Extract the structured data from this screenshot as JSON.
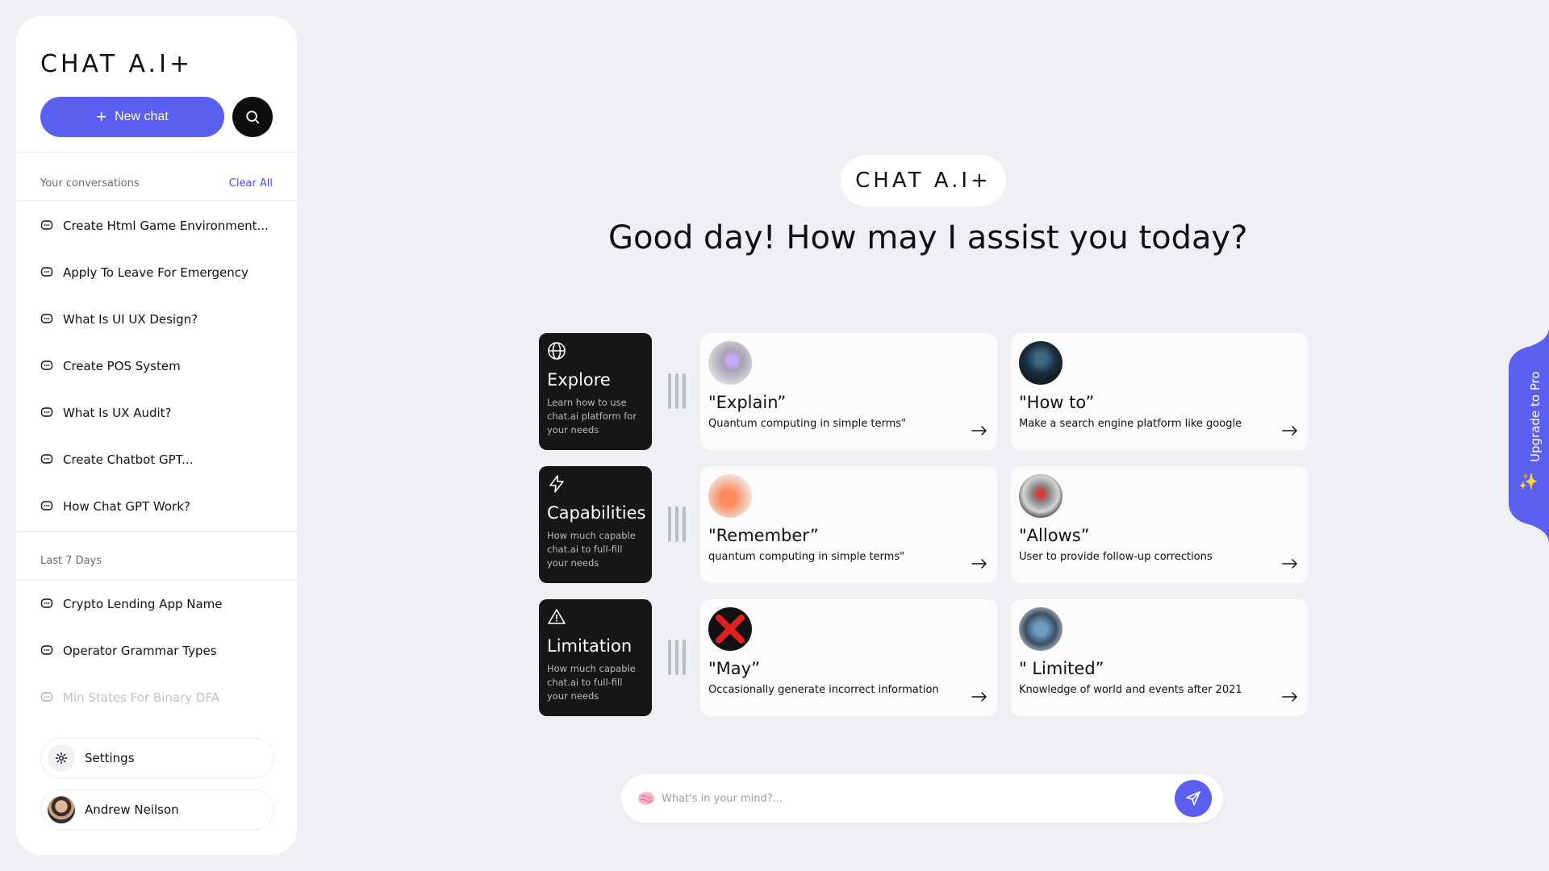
{
  "sidebar": {
    "logo": "CHAT A.I+",
    "new_chat_label": "New chat",
    "conversations_heading": "Your conversations",
    "clear_all_label": "Clear All",
    "conversations": [
      "Create Html Game Environment...",
      "Apply To Leave For Emergency",
      "What Is UI UX Design?",
      "Create POS System",
      "What Is UX Audit?",
      "Create Chatbot GPT...",
      "How Chat GPT Work?"
    ],
    "last7_heading": "Last 7 Days",
    "last7": [
      "Crypto Lending App Name",
      "Operator Grammar Types",
      "Min States For Binary DFA"
    ],
    "settings_label": "Settings",
    "user_name": "Andrew Neilson"
  },
  "main": {
    "brand": "CHAT A.I+",
    "greeting": "Good day! How may I assist you today?",
    "categories": [
      {
        "icon": "globe-icon",
        "title": "Explore",
        "desc": "Learn how to use chat.ai platform for your needs"
      },
      {
        "icon": "lightning-icon",
        "title": "Capabilities",
        "desc": "How much capable chat.ai to full-fill your needs"
      },
      {
        "icon": "warning-icon",
        "title": "Limitation",
        "desc": "How much capable chat.ai to full-fill your needs"
      }
    ],
    "prompts": [
      {
        "title": "\"Explain”",
        "subtitle": "Quantum computing in simple terms\""
      },
      {
        "title": "\"How to”",
        "subtitle": "Make a search engine platform like google"
      },
      {
        "title": "\"Remember”",
        "subtitle": "quantum computing in simple terms\""
      },
      {
        "title": "\"Allows”",
        "subtitle": "User to provide follow-up corrections"
      },
      {
        "title": "\"May”",
        "subtitle": "Occasionally generate incorrect information"
      },
      {
        "title": "\" Limited”",
        "subtitle": "Knowledge of world and events after 2021"
      }
    ],
    "input_placeholder": "What's in your mind?...",
    "upgrade_label": "Upgrade to Pro"
  },
  "colors": {
    "accent": "#5b5ff0",
    "background": "#eef0f3",
    "card_dark": "#161616"
  }
}
